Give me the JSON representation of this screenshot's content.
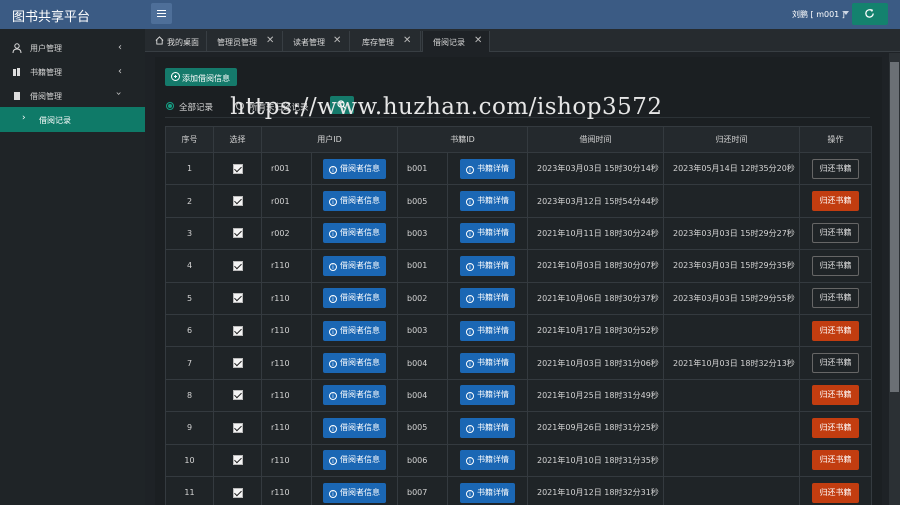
{
  "header": {
    "brand": "图书共享平台",
    "user": "刘鹏 [ m001 ]"
  },
  "sidebar": {
    "items": [
      {
        "label": "用户管理",
        "icon": "user-icon"
      },
      {
        "label": "书籍管理",
        "icon": "books-icon"
      },
      {
        "label": "借阅管理",
        "icon": "book-icon"
      }
    ],
    "sub_item": "借阅记录"
  },
  "tabs": [
    {
      "label": "我的桌面"
    },
    {
      "label": "管理员管理"
    },
    {
      "label": "读者管理"
    },
    {
      "label": "库存管理"
    },
    {
      "label": "借阅记录"
    }
  ],
  "toolbar": {
    "add_label": "添加借阅信息",
    "filter_all": "全部记录",
    "filter_unreturned": "所有未归还记录"
  },
  "watermark": "https://www.huzhan.com/ishop3572",
  "table": {
    "headers": [
      "序号",
      "选择",
      "用户ID",
      "书籍ID",
      "借阅时间",
      "归还时间",
      "操作"
    ],
    "user_btn": "借阅者信息",
    "book_btn": "书籍详情",
    "return_btn": "归还书籍",
    "rows": [
      {
        "no": "1",
        "user": "r001",
        "book": "b001",
        "borrow": "2023年03月03日 15时30分14秒",
        "return": "2023年05月14日 12时35分20秒",
        "returned": true
      },
      {
        "no": "2",
        "user": "r001",
        "book": "b005",
        "borrow": "2023年03月12日 15时54分44秒",
        "return": "",
        "returned": false
      },
      {
        "no": "3",
        "user": "r002",
        "book": "b003",
        "borrow": "2021年10月11日 18时30分24秒",
        "return": "2023年03月03日 15时29分27秒",
        "returned": true
      },
      {
        "no": "4",
        "user": "r110",
        "book": "b001",
        "borrow": "2021年10月03日 18时30分07秒",
        "return": "2023年03月03日 15时29分35秒",
        "returned": true
      },
      {
        "no": "5",
        "user": "r110",
        "book": "b002",
        "borrow": "2021年10月06日 18时30分37秒",
        "return": "2023年03月03日 15时29分55秒",
        "returned": true
      },
      {
        "no": "6",
        "user": "r110",
        "book": "b003",
        "borrow": "2021年10月17日 18时30分52秒",
        "return": "",
        "returned": false
      },
      {
        "no": "7",
        "user": "r110",
        "book": "b004",
        "borrow": "2021年10月03日 18时31分06秒",
        "return": "2021年10月03日 18时32分13秒",
        "returned": true
      },
      {
        "no": "8",
        "user": "r110",
        "book": "b004",
        "borrow": "2021年10月25日 18时31分49秒",
        "return": "",
        "returned": false
      },
      {
        "no": "9",
        "user": "r110",
        "book": "b005",
        "borrow": "2021年09月26日 18时31分25秒",
        "return": "",
        "returned": false
      },
      {
        "no": "10",
        "user": "r110",
        "book": "b006",
        "borrow": "2021年10月10日 18时31分35秒",
        "return": "",
        "returned": false
      },
      {
        "no": "11",
        "user": "r110",
        "book": "b007",
        "borrow": "2021年10月12日 18时32分31秒",
        "return": "",
        "returned": false
      }
    ]
  }
}
